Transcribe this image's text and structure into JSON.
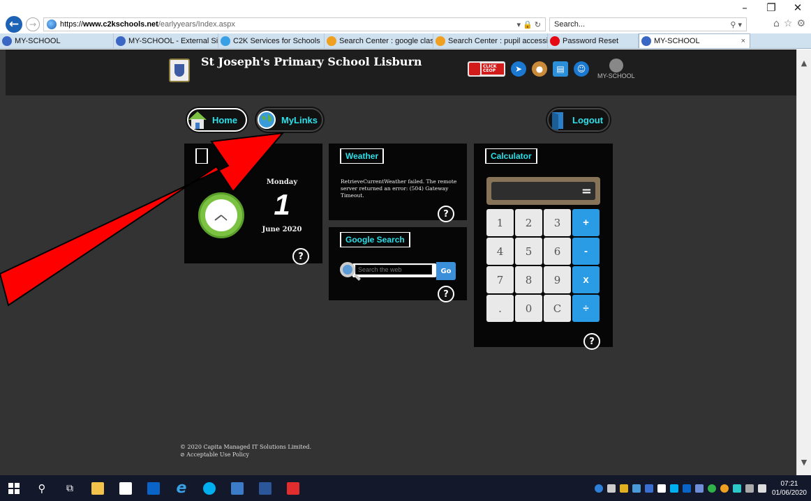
{
  "browser": {
    "url": {
      "scheme": "https://",
      "host": "www.c2kschools.net",
      "path": "/earlyyears/Index.aspx"
    },
    "address_tools": "▾ 🔒 ↻",
    "search_placeholder": "Search...",
    "tabs": [
      {
        "label": "MY-SCHOOL",
        "icon": "myschool-icon",
        "color": "#3a66c4"
      },
      {
        "label": "MY-SCHOOL - External Site",
        "icon": "myschool-icon",
        "color": "#3a66c4"
      },
      {
        "label": "C2K Services for Schools",
        "icon": "ie-icon",
        "color": "#3aa0e6"
      },
      {
        "label": "Search Center : google classr...",
        "icon": "search-center-icon",
        "color": "#f0a020"
      },
      {
        "label": "Search Center : pupil accessi...",
        "icon": "search-center-icon",
        "color": "#f0a020"
      },
      {
        "label": "Password Reset",
        "icon": "netflix-n-icon",
        "color": "#e50914"
      },
      {
        "label": "MY-SCHOOL",
        "icon": "myschool-icon",
        "color": "#3a66c4",
        "active": true
      }
    ]
  },
  "site": {
    "school_name": "St Joseph's Primary School Lisburn",
    "ceop_label": "CLICK CEOP",
    "myschool_label": "MY-SCHOOL",
    "nav": {
      "home": "Home",
      "mylinks": "MyLinks",
      "logout": "Logout"
    },
    "clock_widget": {
      "day": "Monday",
      "date": "1",
      "month_year": "June 2020"
    },
    "weather_widget": {
      "title": "Weather",
      "message": "RetrieveCurrentWeather failed. The remote server returned an error: (504) Gateway Timeout."
    },
    "google_widget": {
      "title": "Google Search",
      "placeholder": "Search the web",
      "go_label": "Go"
    },
    "calc_widget": {
      "title": "Calculator",
      "display_symbol": "=",
      "keys": [
        "1",
        "2",
        "3",
        "+",
        "4",
        "5",
        "6",
        "-",
        "7",
        "8",
        "9",
        "x",
        ".",
        "0",
        "C",
        "÷"
      ]
    },
    "help_label": "?",
    "footer": {
      "copyright": "© 2020 Capita Managed IT Solutions Limited.",
      "policy": "Acceptable Use Policy"
    }
  },
  "taskbar": {
    "time": "07:21",
    "date": "01/06/2020"
  },
  "colors": {
    "accent_cyan": "#2ce0ea",
    "arrow_red": "#ff0000",
    "page_bg": "#333333"
  }
}
